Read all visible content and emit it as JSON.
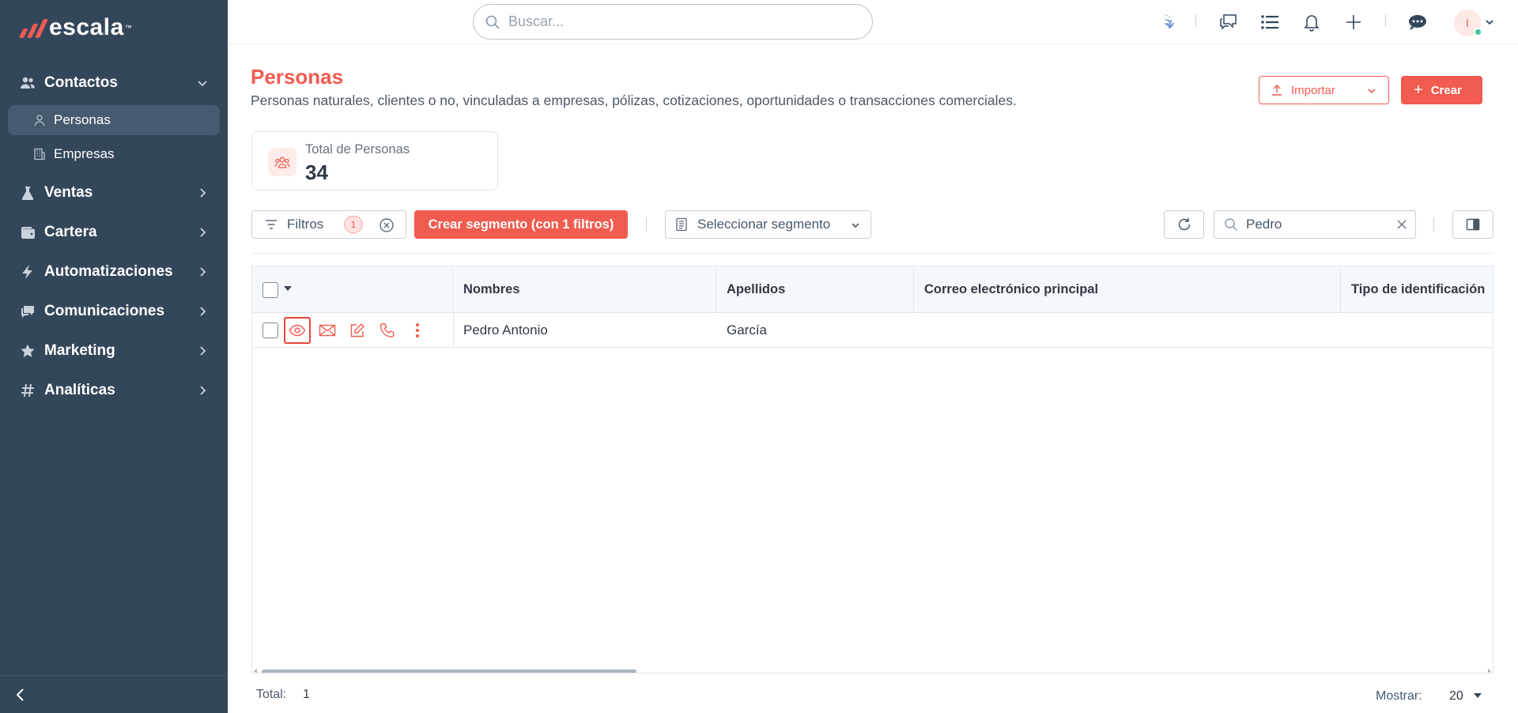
{
  "brand": {
    "name": "escala",
    "tm": "™",
    "accent_color": "#f15b50",
    "sidebar_color": "#33475b"
  },
  "sidebar": {
    "items": [
      {
        "label": "Contactos",
        "icon": "users-icon",
        "expanded": true
      },
      {
        "label": "Ventas",
        "icon": "flask-icon"
      },
      {
        "label": "Cartera",
        "icon": "wallet-icon"
      },
      {
        "label": "Automatizaciones",
        "icon": "bolt-icon"
      },
      {
        "label": "Comunicaciones",
        "icon": "chat-icon"
      },
      {
        "label": "Marketing",
        "icon": "star-icon"
      },
      {
        "label": "Analíticas",
        "icon": "hash-icon"
      }
    ],
    "subitems": [
      {
        "label": "Personas",
        "icon": "person-icon",
        "active": true
      },
      {
        "label": "Empresas",
        "icon": "building-icon"
      }
    ]
  },
  "topbar": {
    "search_placeholder": "Buscar...",
    "avatar_initial": "I"
  },
  "header": {
    "title": "Personas",
    "subtitle": "Personas naturales, clientes o no, vinculadas a empresas, pólizas, cotizaciones, oportunidades o transacciones comerciales.",
    "import_label": "Importar",
    "create_label": "Crear",
    "create_plus": "+"
  },
  "stats": {
    "label": "Total de Personas",
    "value": "34"
  },
  "filters": {
    "label": "Filtros",
    "count": "1",
    "segment_button": "Crear segmento (con 1 filtros)",
    "select_segment": "Seleccionar segmento",
    "search_value": "Pedro"
  },
  "table": {
    "columns": [
      "Nombres",
      "Apellidos",
      "Correo electrónico principal",
      "Tipo de identificación"
    ],
    "rows": [
      {
        "nombres": "Pedro Antonio",
        "apellidos": "García",
        "correo": "",
        "tipo": ""
      }
    ]
  },
  "footer": {
    "total_label": "Total:",
    "total_value": "1",
    "show_label": "Mostrar:",
    "show_value": "20"
  }
}
